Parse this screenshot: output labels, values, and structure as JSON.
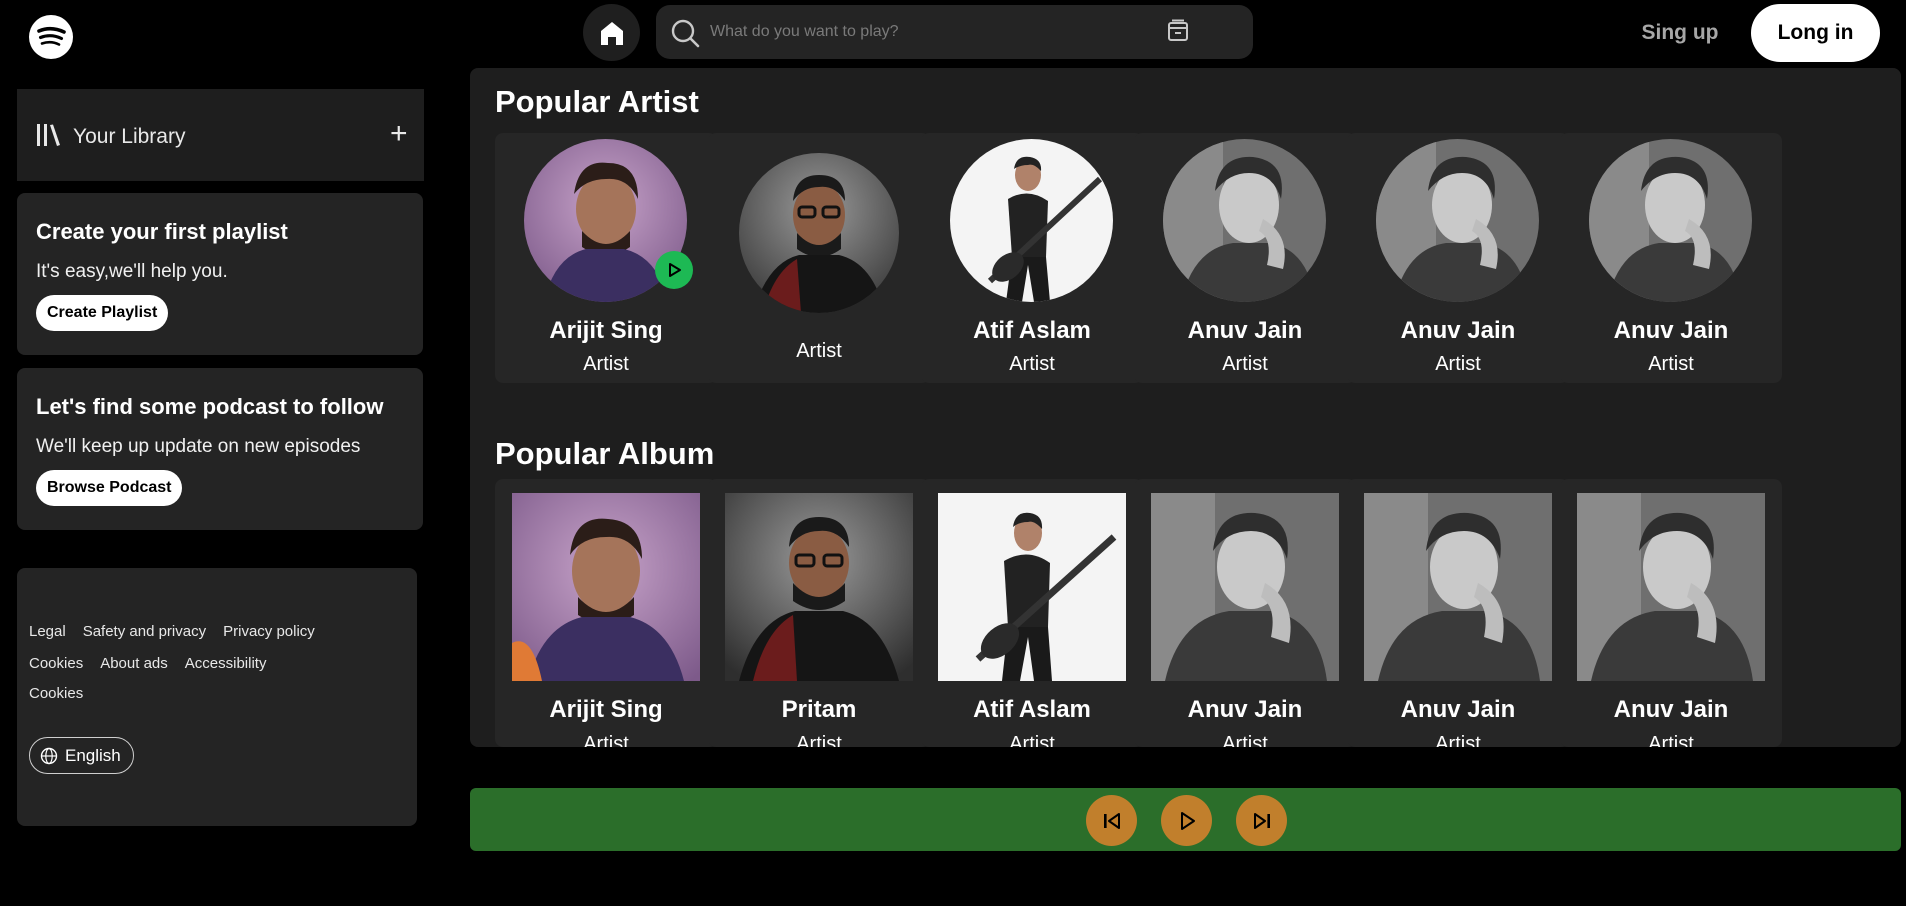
{
  "header": {
    "logo": "spotify-logo",
    "home_icon": "home-icon",
    "search_placeholder": "What do you want to play?",
    "search_icon": "search-icon",
    "browse_icon": "browse-icon",
    "signup_label": "Sing up",
    "login_label": "Long in"
  },
  "sidebar": {
    "library_label": "Your Library",
    "add_label": "+",
    "playlist_card": {
      "title": "Create your first playlist",
      "subtitle": "It's easy,we'll help you.",
      "button": "Create Playlist"
    },
    "podcast_card": {
      "title": "Let's find some podcast to follow",
      "subtitle": "We'll keep up update on new episodes",
      "button": "Browse Podcast"
    },
    "footer": {
      "row1": [
        "Legal",
        "Safety and privacy",
        "Privacy policy"
      ],
      "row2": [
        "Cookies",
        "About ads",
        "Accessibility"
      ],
      "row3": [
        "Cookies"
      ],
      "language": "English"
    }
  },
  "main": {
    "popular_artist_title": "Popular Artist",
    "popular_album_title": "Popular Album",
    "artists": [
      {
        "name": "Arijit Sing",
        "role": "Artist"
      },
      {
        "name": "",
        "role": "Artist"
      },
      {
        "name": "Atif Aslam",
        "role": "Artist"
      },
      {
        "name": "Anuv Jain",
        "role": "Artist"
      },
      {
        "name": "Anuv Jain",
        "role": "Artist"
      },
      {
        "name": "Anuv Jain",
        "role": "Artist"
      }
    ],
    "albums": [
      {
        "name": "Arijit Sing",
        "role": "Artist"
      },
      {
        "name": "Pritam",
        "role": "Artist"
      },
      {
        "name": "Atif Aslam",
        "role": "Artist"
      },
      {
        "name": "Anuv Jain",
        "role": "Artist"
      },
      {
        "name": "Anuv Jain",
        "role": "Artist"
      },
      {
        "name": "Anuv Jain",
        "role": "Artist"
      }
    ]
  },
  "player": {
    "prev_icon": "skip-back-icon",
    "play_icon": "play-icon",
    "next_icon": "skip-forward-icon"
  },
  "colors": {
    "background": "#000000",
    "panel": "#1e1e1e",
    "accent_green": "#1db954",
    "player_bar": "#2b6e2a",
    "player_button": "#c17f2c"
  }
}
